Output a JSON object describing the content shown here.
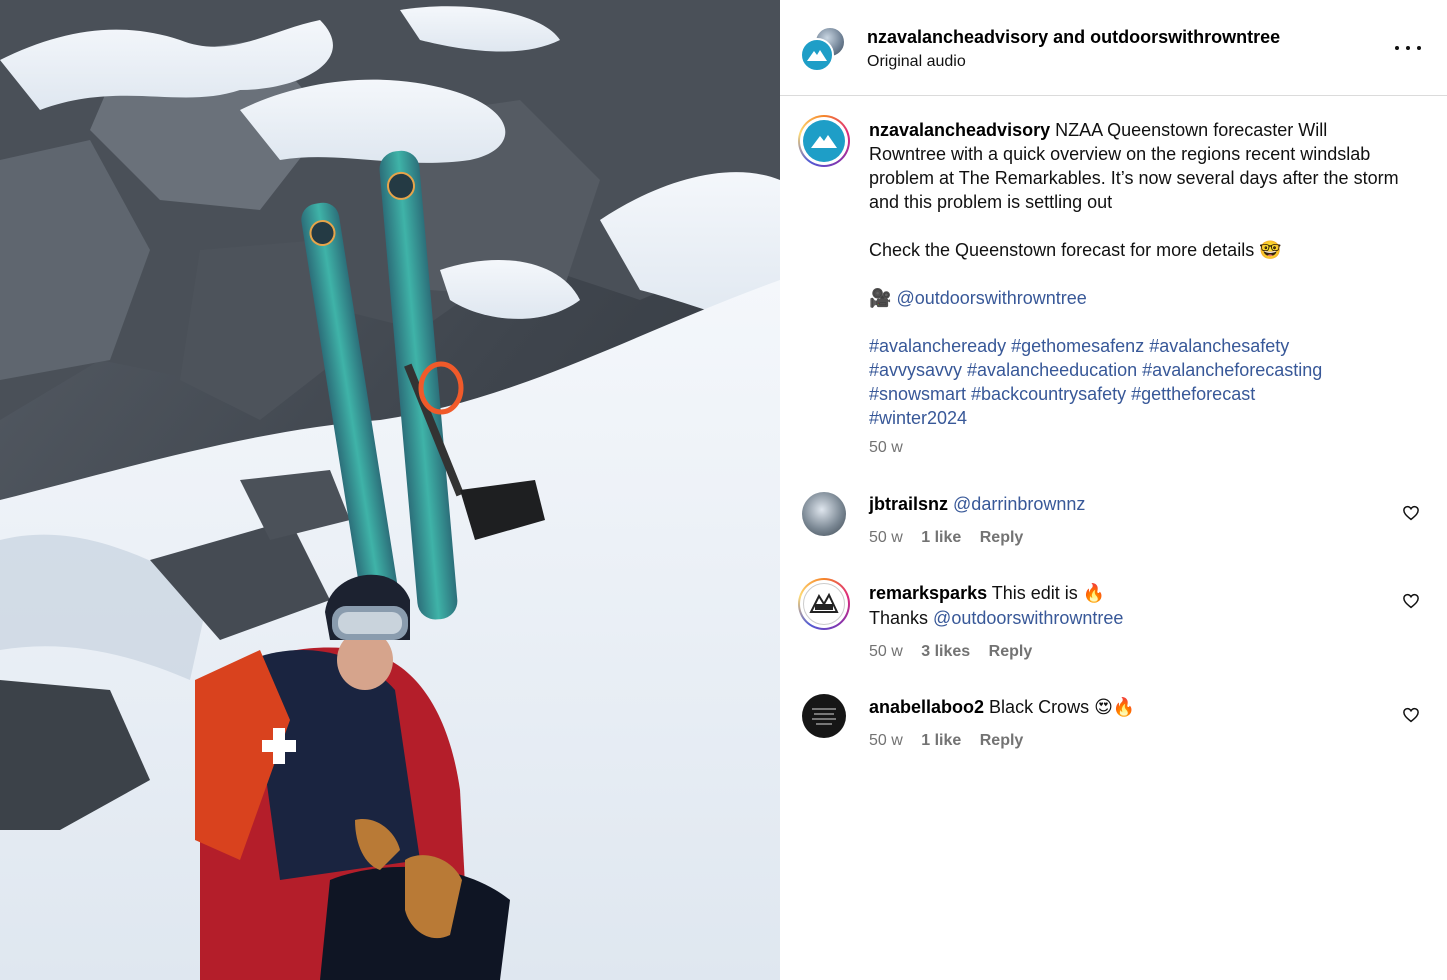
{
  "media": {
    "description_icon": "video-frame"
  },
  "header": {
    "owner_primary": "nzavalancheadvisory",
    "owner_joiner": "and",
    "owner_secondary": "outdoorswithrowntree",
    "audio_label": "Original audio",
    "more_icon": "more-horizontal-icon"
  },
  "caption": {
    "username": "nzavalancheadvisory",
    "text": "NZAA Queenstown forecaster Will Rowntree with a quick overview on the regions recent windslab problem at The Remarkables. It’s now several days after the storm and this problem is settling out",
    "para2": "Check the Queenstown forecast for more details 🤓",
    "camera_emoji": "🎥",
    "mention": "@outdoorswithrowntree",
    "hashtags_line1": "#avalancheready #gethomesafenz #avalanchesafety",
    "hashtags_line2": "#avvysavvy #avalancheeducation #avalancheforecasting",
    "hashtags_line3": "#snowsmart #backcountrysafety #gettheforecast",
    "hashtags_line4": "#winter2024",
    "time": "50 w"
  },
  "comments": [
    {
      "username": "jbtrailsnz",
      "text": "",
      "mention": "@darrinbrownnz",
      "line2_prefix": "",
      "line2_mention": "",
      "time": "50 w",
      "likes": "1 like",
      "reply": "Reply"
    },
    {
      "username": "remarksparks",
      "text": "This edit is 🔥",
      "mention": "",
      "line2_prefix": "Thanks",
      "line2_mention": "@outdoorswithrowntree",
      "time": "50 w",
      "likes": "3 likes",
      "reply": "Reply"
    },
    {
      "username": "anabellaboo2",
      "text": "Black Crows 😍🔥",
      "mention": "",
      "line2_prefix": "",
      "line2_mention": "",
      "time": "50 w",
      "likes": "1 like",
      "reply": "Reply"
    }
  ],
  "colors": {
    "link": "#385898",
    "meta": "#737373",
    "brand_avatar": "#1e9ec7",
    "divider": "#dbdbdb"
  }
}
